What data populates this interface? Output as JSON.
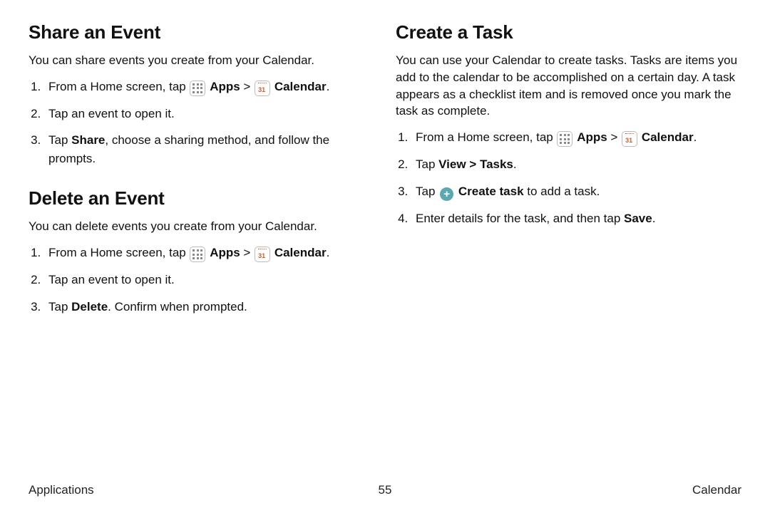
{
  "left": {
    "section1": {
      "heading": "Share an Event",
      "intro": "You can share events you create from your Calendar.",
      "steps": {
        "s1a": "From a Home screen, tap ",
        "s1_apps": "Apps",
        "s1_sep": " > ",
        "s1_cal": "Calendar",
        "s1_end": ".",
        "s2": "Tap an event to open it.",
        "s3a": "Tap ",
        "s3_share": "Share",
        "s3b": ", choose a sharing method, and follow the prompts."
      }
    },
    "section2": {
      "heading": "Delete an Event",
      "intro": "You can delete events you create from your Calendar.",
      "steps": {
        "s1a": "From a Home screen, tap ",
        "s1_apps": "Apps",
        "s1_sep": " > ",
        "s1_cal": "Calendar",
        "s1_end": ".",
        "s2": "Tap an event to open it.",
        "s3a": "Tap ",
        "s3_del": "Delete",
        "s3b": ". Confirm when prompted."
      }
    }
  },
  "right": {
    "section1": {
      "heading": "Create a Task",
      "intro": "You can use your Calendar to create tasks. Tasks are items you add to the calendar to be accomplished on a certain day. A task appears as a checklist item and is removed once you mark the task as complete.",
      "steps": {
        "s1a": "From a Home screen, tap ",
        "s1_apps": "Apps",
        "s1_sep": " > ",
        "s1_cal": "Calendar",
        "s1_end": ".",
        "s2a": "Tap ",
        "s2_view": "View > Tasks",
        "s2b": ".",
        "s3a": "Tap ",
        "s3_create": "Create task",
        "s3b": " to add a task.",
        "s4a": "Enter details for the task, and then tap ",
        "s4_save": "Save",
        "s4b": "."
      }
    }
  },
  "footer": {
    "left": "Applications",
    "center": "55",
    "right": "Calendar"
  }
}
